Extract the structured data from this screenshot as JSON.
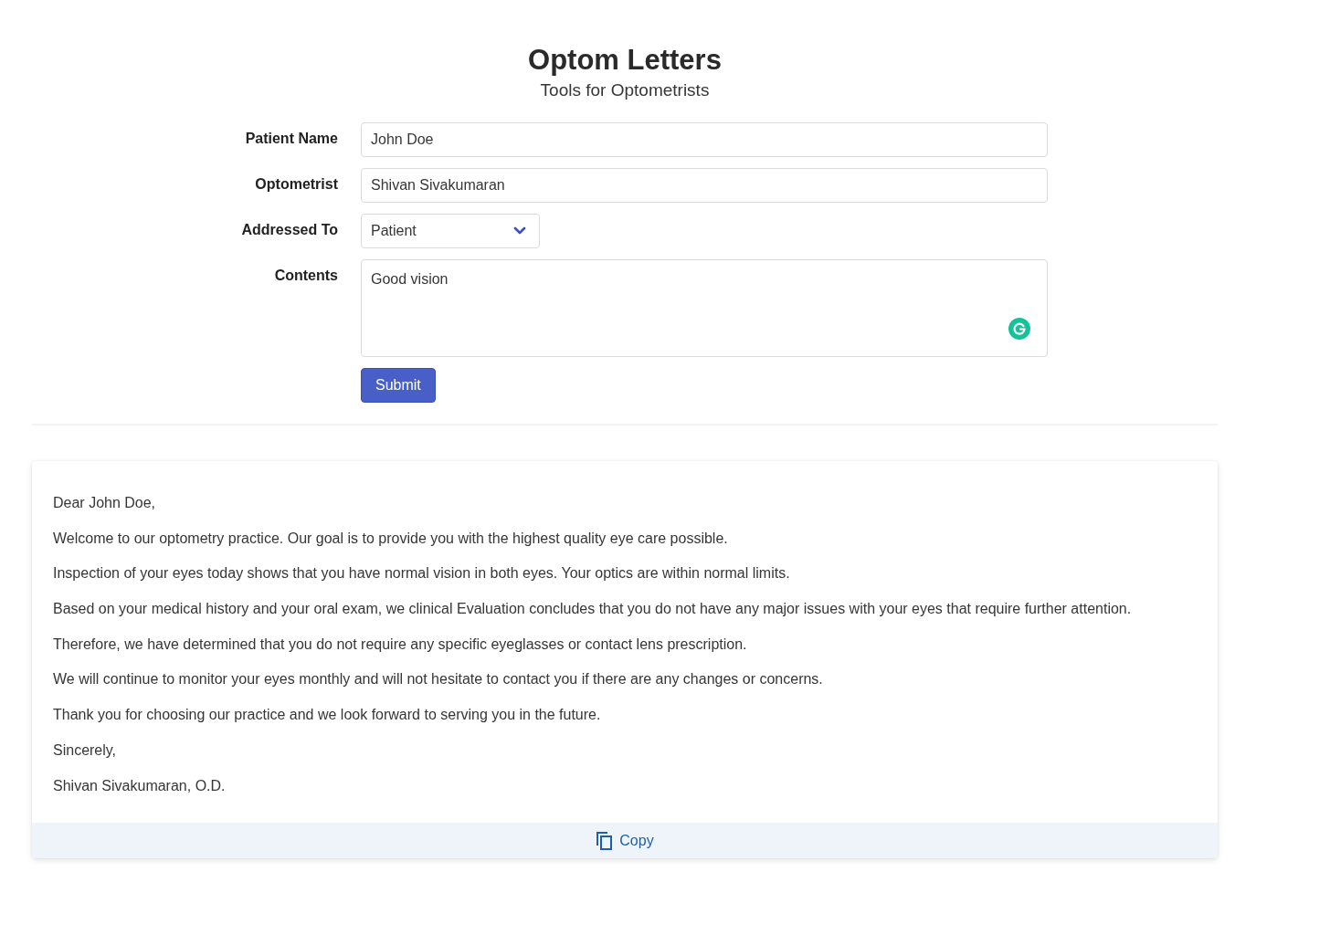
{
  "header": {
    "title": "Optom Letters",
    "subtitle": "Tools for Optometrists"
  },
  "form": {
    "fields": [
      {
        "kind": "text",
        "label": "Patient Name",
        "value": "John Doe"
      },
      {
        "kind": "text",
        "label": "Optometrist",
        "value": "Shivan Sivakumaran"
      },
      {
        "kind": "select",
        "label": "Addressed To",
        "value": "Patient"
      },
      {
        "kind": "textarea",
        "label": "Contents",
        "value": "Good vision"
      }
    ],
    "submit": "Submit"
  },
  "letter": {
    "paragraphs": [
      "Dear John Doe,",
      "Welcome to our optometry practice. Our goal is to provide you with the highest quality eye care possible.",
      "Inspection of your eyes today shows that you have normal vision in both eyes. Your optics are within normal limits.",
      "Based on your medical history and your oral exam, we clinical Evaluation concludes that you do not have any major issues with your eyes that require further attention.",
      "Therefore, we have determined that you do not require any specific eyeglasses or contact lens prescription.",
      "We will continue to monitor your eyes monthly and will not hesitate to contact you if there are any changes or concerns.",
      "Thank you for choosing our practice and we look forward to serving you in the future.",
      "Sincerely,",
      "Shivan Sivakumaran, O.D."
    ],
    "copy": "Copy"
  }
}
